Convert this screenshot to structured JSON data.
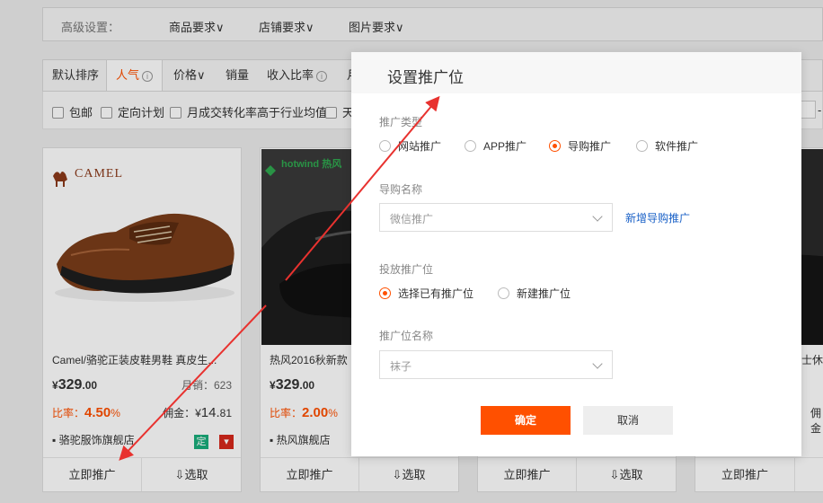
{
  "advanced": {
    "label": "高级设置：",
    "items": [
      "商品要求",
      "店铺要求",
      "图片要求"
    ]
  },
  "sort": {
    "default": "默认排序",
    "popular": "人气",
    "price": "价格",
    "sales": "销量",
    "income_ratio": "收入比率",
    "cut": "月"
  },
  "filters": [
    "包邮",
    "定向计划",
    "月成交转化率高于行业均值",
    "天"
  ],
  "filter_right": "-",
  "cards": [
    {
      "brand": "CAMEL",
      "title": "Camel/骆驼正装皮鞋男鞋 真皮生...",
      "price_symbol": "¥",
      "price_int": "329",
      "price_dec": ".00",
      "sales_label": "月销：",
      "sales": "623",
      "rate_label": "比率：",
      "rate_int": "4.",
      "rate_dec": "50",
      "rate_unit": "%",
      "comm_label": "佣金：¥",
      "comm_int": "14.",
      "comm_dec": "81",
      "shop": "骆驼服饰旗舰店",
      "badge1": "定",
      "action_promote": "立即推广",
      "action_select": "⇩选取"
    },
    {
      "brand": "hotwind 热风",
      "title": "热风2016秋新款",
      "price_symbol": "¥",
      "price_int": "329",
      "price_dec": ".00",
      "rate_label": "比率：",
      "rate_int": "2.",
      "rate_dec": "00",
      "rate_unit": "%",
      "shop": "热风旗舰店",
      "action_promote": "立即推广",
      "action_select": "⇩选取"
    },
    {
      "action_promote": "立即推广",
      "action_select": "⇩选取"
    },
    {
      "title_tail": "士休",
      "comm_tail": "佣金",
      "action_promote": "立即推广"
    }
  ],
  "modal": {
    "title": "设置推广位",
    "promo_type_label": "推广类型",
    "promo_types": [
      "网站推广",
      "APP推广",
      "导购推广",
      "软件推广"
    ],
    "selected_type": "导购推广",
    "guide_name_label": "导购名称",
    "guide_name_value": "微信推广",
    "add_guide_link": "新增导购推广",
    "placement_label": "投放推广位",
    "placement_options": [
      "选择已有推广位",
      "新建推广位"
    ],
    "selected_placement": "选择已有推广位",
    "slot_name_label": "推广位名称",
    "slot_name_value": "袜子",
    "confirm": "确定",
    "cancel": "取消"
  },
  "colors": {
    "accent": "#ff5000",
    "link": "#1a61c7",
    "annotation_arrow": "#e8322f"
  }
}
